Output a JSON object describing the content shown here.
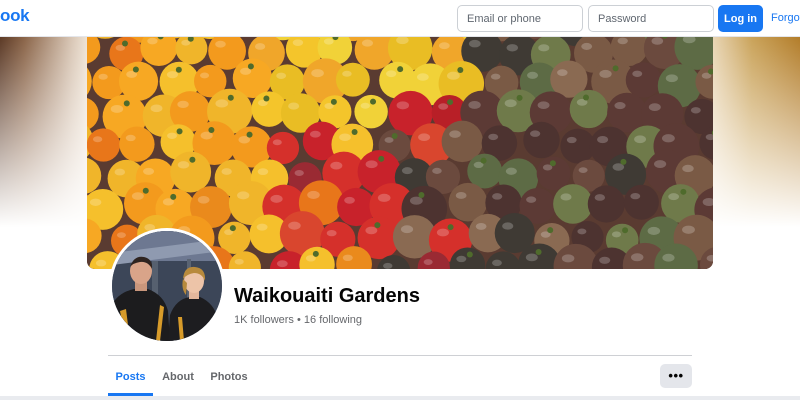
{
  "header": {
    "logo_text": "ook",
    "email_placeholder": "Email or phone",
    "password_placeholder": "Password",
    "login_label": "Log in",
    "forgot_label": "Forgot"
  },
  "profile": {
    "name": "Waikouaiti Gardens",
    "followers": "1K followers",
    "separator": "•",
    "following": "16 following"
  },
  "tabs": [
    {
      "label": "Posts",
      "active": true
    },
    {
      "label": "About",
      "active": false
    },
    {
      "label": "Photos",
      "active": false
    }
  ],
  "more_button": {
    "icon": "more-horizontal-icon",
    "glyph": "•••"
  },
  "colors": {
    "brand": "#1877f2",
    "text_primary": "#050505",
    "text_secondary": "#65676b",
    "button_gray": "#e4e6eb"
  }
}
